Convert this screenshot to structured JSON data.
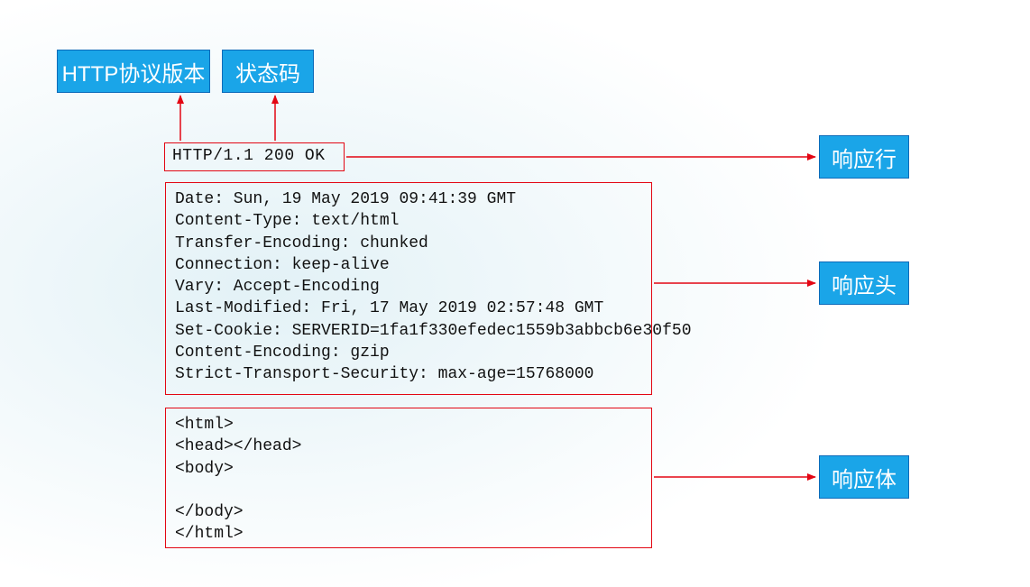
{
  "labels": {
    "http_version": "HTTP协议版本",
    "status_code": "状态码",
    "response_line": "响应行",
    "response_header": "响应头",
    "response_body": "响应体"
  },
  "status_line": "HTTP/1.1 200 OK",
  "headers_block": "Date: Sun, 19 May 2019 09:41:39 GMT\nContent-Type: text/html\nTransfer-Encoding: chunked\nConnection: keep-alive\nVary: Accept-Encoding\nLast-Modified: Fri, 17 May 2019 02:57:48 GMT\nSet-Cookie: SERVERID=1fa1f330efedec1559b3abbcb6e30f50\nContent-Encoding: gzip\nStrict-Transport-Security: max-age=15768000",
  "body_block": "<html>\n<head></head>\n<body>\n\n</body>\n</html>"
}
